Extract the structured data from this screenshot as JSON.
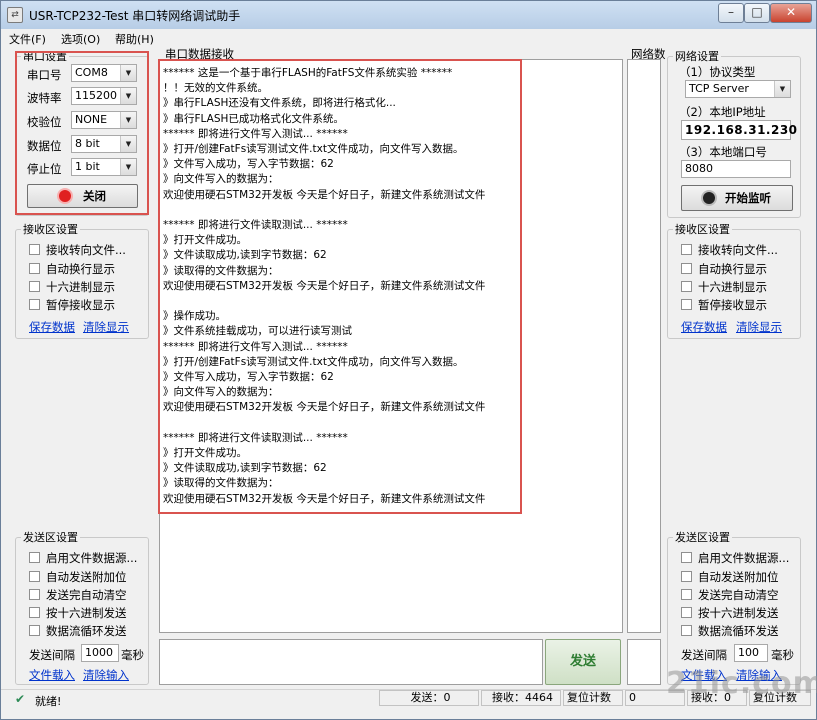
{
  "window": {
    "title": "USR-TCP232-Test 串口转网络调试助手",
    "controls": {
      "minimize": "–",
      "maximize": "□",
      "close": "✕"
    }
  },
  "menu": [
    "文件(F)",
    "选项(O)",
    "帮助(H)"
  ],
  "serial": {
    "group_title": "串口设置",
    "port_label": "串口号",
    "port_value": "COM8",
    "baud_label": "波特率",
    "baud_value": "115200",
    "parity_label": "校验位",
    "parity_value": "NONE",
    "databits_label": "数据位",
    "databits_value": "8 bit",
    "stopbits_label": "停止位",
    "stopbits_value": "1 bit",
    "close_button": "关闭",
    "indicator_color": "#e02020"
  },
  "rx_settings_left": {
    "group_title": "接收区设置",
    "options": [
      "接收转向文件...",
      "自动换行显示",
      "十六进制显示",
      "暂停接收显示"
    ],
    "save_link": "保存数据",
    "clear_link": "清除显示"
  },
  "tx_settings_left": {
    "group_title": "发送区设置",
    "options": [
      "启用文件数据源...",
      "自动发送附加位",
      "发送完自动清空",
      "按十六进制发送",
      "数据流循环发送"
    ],
    "interval_label": "发送间隔",
    "interval_value": "1000",
    "interval_unit": "毫秒",
    "load_link": "文件载入",
    "clear_link": "清除输入"
  },
  "serial_rx": {
    "group_title": "串口数据接收",
    "lines": [
      "****** 这是一个基于串行FLASH的FatFS文件系统实验 ******",
      "！！无效的文件系统。",
      "》串行FLASH还没有文件系统，即将进行格式化...",
      "》串行FLASH已成功格式化文件系统。",
      "****** 即将进行文件写入测试... ******",
      "》打开/创建FatFs读写测试文件.txt文件成功，向文件写入数据。",
      "》文件写入成功，写入字节数据：62",
      "》向文件写入的数据为：",
      "欢迎使用硬石STM32开发板 今天是个好日子，新建文件系统测试文件",
      "",
      "****** 即将进行文件读取测试... ******",
      "》打开文件成功。",
      "》文件读取成功,读到字节数据：62",
      "》读取得的文件数据为：",
      "欢迎使用硬石STM32开发板 今天是个好日子，新建文件系统测试文件",
      "",
      "》操作成功。",
      "》文件系统挂载成功，可以进行读写测试",
      "****** 即将进行文件写入测试... ******",
      "》打开/创建FatFs读写测试文件.txt文件成功，向文件写入数据。",
      "》文件写入成功，写入字节数据：62",
      "》向文件写入的数据为：",
      "欢迎使用硬石STM32开发板 今天是个好日子，新建文件系统测试文件",
      "",
      "****** 即将进行文件读取测试... ******",
      "》打开文件成功。",
      "》文件读取成功,读到字节数据：62",
      "》读取得的文件数据为：",
      "欢迎使用硬石STM32开发板 今天是个好日子，新建文件系统测试文件"
    ]
  },
  "network_rx": {
    "group_title": "网络数"
  },
  "network": {
    "group_title": "网络设置",
    "protocol_label": "（1）协议类型",
    "protocol_value": "TCP Server",
    "ip_label": "（2）本地IP地址",
    "ip_value": "192.168.31.230",
    "port_label": "（3）本地端口号",
    "port_value": "8080",
    "listen_button": "开始监听"
  },
  "rx_settings_right": {
    "group_title": "接收区设置",
    "options": [
      "接收转向文件...",
      "自动换行显示",
      "十六进制显示",
      "暂停接收显示"
    ],
    "save_link": "保存数据",
    "clear_link": "清除显示"
  },
  "tx_settings_right": {
    "group_title": "发送区设置",
    "options": [
      "启用文件数据源...",
      "自动发送附加位",
      "发送完自动清空",
      "按十六进制发送",
      "数据流循环发送"
    ],
    "interval_label": "发送间隔",
    "interval_value": "100",
    "interval_unit": "毫秒",
    "load_link": "文件载入",
    "clear_link": "清除输入"
  },
  "send_button": "发送",
  "status": {
    "ready": "就绪!",
    "sent": "发送：0",
    "received": "接收：4464",
    "reset_count": "复位计数",
    "net_count": "0",
    "net_received": "接收：0",
    "net_reset": "复位计数"
  },
  "watermark": "21ic.com"
}
